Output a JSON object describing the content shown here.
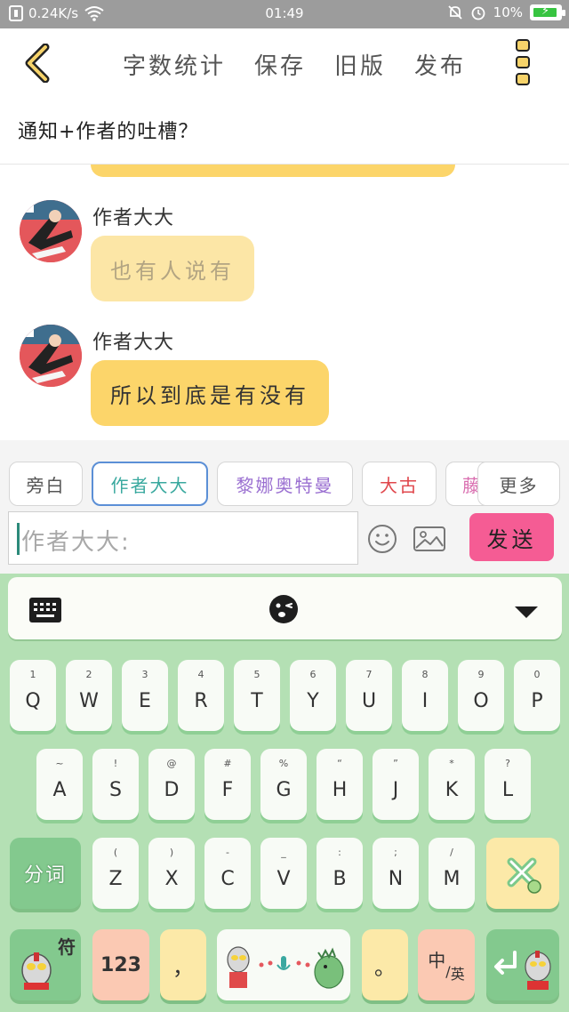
{
  "status_bar": {
    "network_speed": "0.24K/s",
    "time": "01:49",
    "battery": "10%"
  },
  "header": {
    "actions": [
      "字数统计",
      "保存",
      "旧版",
      "发布"
    ]
  },
  "title": "通知+作者的吐槽？",
  "messages": [
    {
      "author": "作者大大",
      "text": "也有人说有",
      "style": "faded"
    },
    {
      "author": "作者大大",
      "text": "所以到底是有没有",
      "style": "solid"
    }
  ],
  "roles": [
    {
      "label": "旁白",
      "color": "#555555",
      "active": false
    },
    {
      "label": "作者大大",
      "color": "#3aa99f",
      "active": true
    },
    {
      "label": "黎娜奥特曼",
      "color": "#9a6fd1",
      "active": false
    },
    {
      "label": "大古",
      "color": "#e0474c",
      "active": false
    },
    {
      "label": "藤",
      "color": "#d96fb0",
      "active": false
    }
  ],
  "more_label": "更多",
  "input": {
    "placeholder": "作者大大:"
  },
  "send_label": "发送",
  "keyboard": {
    "rows": [
      [
        {
          "main": "Q",
          "sub": "1"
        },
        {
          "main": "W",
          "sub": "2"
        },
        {
          "main": "E",
          "sub": "3"
        },
        {
          "main": "R",
          "sub": "4"
        },
        {
          "main": "T",
          "sub": "5"
        },
        {
          "main": "Y",
          "sub": "6"
        },
        {
          "main": "U",
          "sub": "7"
        },
        {
          "main": "I",
          "sub": "8"
        },
        {
          "main": "O",
          "sub": "9"
        },
        {
          "main": "P",
          "sub": "0"
        }
      ],
      [
        {
          "main": "A",
          "sub": "~"
        },
        {
          "main": "S",
          "sub": "!"
        },
        {
          "main": "D",
          "sub": "@"
        },
        {
          "main": "F",
          "sub": "#"
        },
        {
          "main": "G",
          "sub": "%"
        },
        {
          "main": "H",
          "sub": "“"
        },
        {
          "main": "J",
          "sub": "”"
        },
        {
          "main": "K",
          "sub": "*"
        },
        {
          "main": "L",
          "sub": "?"
        }
      ],
      [
        {
          "main": "Z",
          "sub": "("
        },
        {
          "main": "X",
          "sub": ")"
        },
        {
          "main": "C",
          "sub": "-"
        },
        {
          "main": "V",
          "sub": "_"
        },
        {
          "main": "B",
          "sub": ":"
        },
        {
          "main": "N",
          "sub": ";"
        },
        {
          "main": "M",
          "sub": "/"
        }
      ]
    ],
    "segment_label": "分词",
    "symbol_label": "符",
    "number_label": "123",
    "comma_label": "，",
    "period_label": "。",
    "lang_zh": "中",
    "lang_en": "英",
    "colors": {
      "background": "#b4e0b4",
      "key": "#f8fbf6",
      "function_key": "#83c98e",
      "accent_key": "#fbc9b3",
      "yellow_key": "#fce9a8"
    }
  }
}
